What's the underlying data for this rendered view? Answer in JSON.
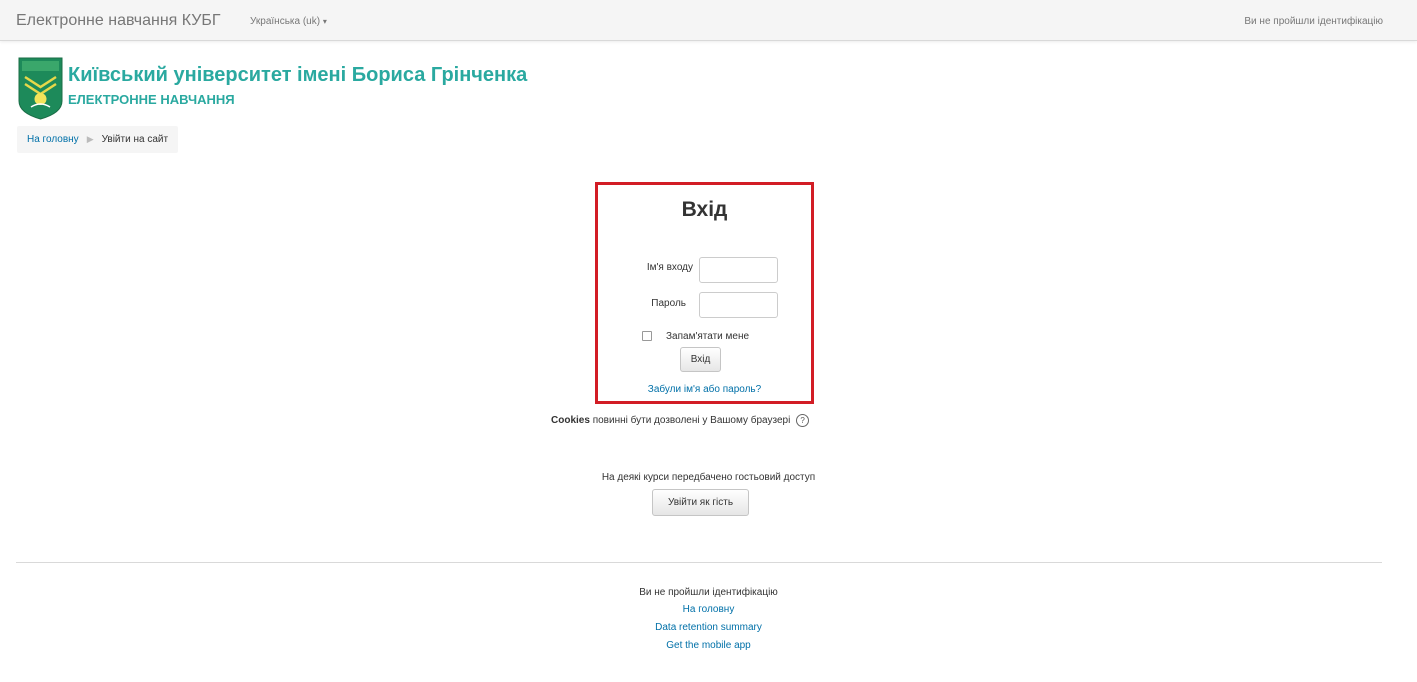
{
  "navbar": {
    "brand": "Електронне навчання КУБГ",
    "language": "Українська (uk)",
    "user_status": "Ви не пройшли ідентифікацію"
  },
  "header": {
    "university": "Київський університет імені Бориса Грінченка",
    "subtitle": "ЕЛЕКТРОННЕ НАВЧАННЯ"
  },
  "breadcrumb": {
    "home": "На головну",
    "current": "Увійти на сайт"
  },
  "login": {
    "title": "Вхід",
    "username_label": "Ім'я входу",
    "username_value": "",
    "password_label": "Пароль",
    "password_value": "",
    "remember_label": "Запам'ятати мене",
    "remember_checked": false,
    "submit_label": "Вхід",
    "forgot_link": "Забули ім'я або пароль?"
  },
  "cookies": {
    "bold": "Cookies",
    "text": "повинні бути дозволені у Вашому браузері"
  },
  "guest": {
    "text": "На деякі курси передбачено гостьовий доступ",
    "button": "Увійти як гість"
  },
  "footer": {
    "status": "Ви не пройшли ідентифікацію",
    "home": "На головну",
    "data_retention": "Data retention summary",
    "mobile_app": "Get the mobile app"
  },
  "colors": {
    "accent": "#2aa9a0",
    "link": "#0070a8",
    "highlight_border": "#d21d25"
  }
}
